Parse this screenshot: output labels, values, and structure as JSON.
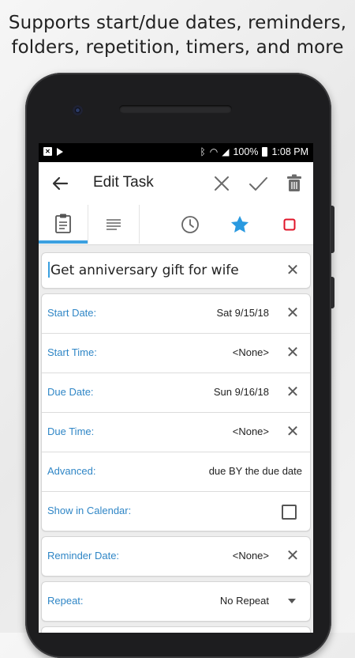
{
  "headline": {
    "line1": "Supports start/due dates, reminders,",
    "line2": "folders, repetition, timers, and more"
  },
  "status_bar": {
    "left_icons": [
      "notification-x-icon",
      "play-store-icon"
    ],
    "right_icons": [
      "bluetooth-icon",
      "wifi-icon",
      "signal-icon"
    ],
    "battery": "100%",
    "time": "1:08 PM"
  },
  "toolbar": {
    "title": "Edit Task",
    "back_icon": "arrow-back-icon",
    "cancel_icon": "close-icon",
    "save_icon": "check-icon",
    "delete_icon": "trash-icon"
  },
  "tabs": [
    {
      "name": "clipboard-icon",
      "active": true
    },
    {
      "name": "notes-icon",
      "active": false
    },
    {
      "name": "clock-icon",
      "active": false
    },
    {
      "name": "star-icon",
      "active": false
    },
    {
      "name": "checkbox-icon",
      "active": false
    }
  ],
  "task": {
    "title": "Get anniversary gift for wife"
  },
  "fields": {
    "start_date": {
      "label": "Start Date:",
      "value": "Sat 9/15/18"
    },
    "start_time": {
      "label": "Start Time:",
      "value": "<None>"
    },
    "due_date": {
      "label": "Due Date:",
      "value": "Sun 9/16/18"
    },
    "due_time": {
      "label": "Due Time:",
      "value": "<None>"
    },
    "advanced": {
      "label": "Advanced:",
      "value": "due BY the due date"
    },
    "show_in_calendar": {
      "label": "Show in Calendar:",
      "checked": false
    },
    "reminder_date": {
      "label": "Reminder Date:",
      "value": "<None>"
    },
    "repeat": {
      "label": "Repeat:",
      "value": "No Repeat"
    }
  },
  "colors": {
    "accent": "#3ba0e0",
    "label": "#2f86c6",
    "star": "#2a9ae0",
    "priority": "#e0152a"
  }
}
